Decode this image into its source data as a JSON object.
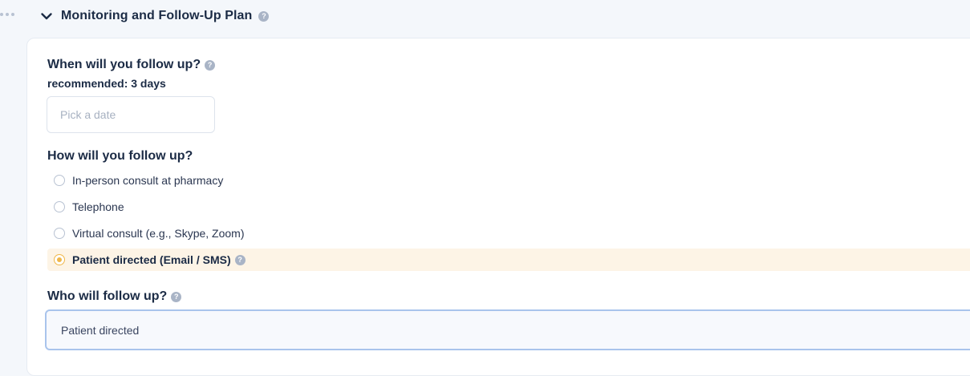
{
  "section": {
    "title": "Monitoring and Follow-Up Plan",
    "help_icon": "question-circle-icon",
    "expand_icon": "chevron-down-icon"
  },
  "follow_up_date": {
    "label": "When will you follow up?",
    "help_icon": "question-circle-icon",
    "recommended": "recommended: 3 days",
    "placeholder": "Pick a date",
    "value": ""
  },
  "follow_up_method": {
    "label": "How will you follow up?",
    "options": [
      {
        "label": "In-person consult at pharmacy",
        "selected": false
      },
      {
        "label": "Telephone",
        "selected": false
      },
      {
        "label": "Virtual consult (e.g., Skype, Zoom)",
        "selected": false
      },
      {
        "label": "Patient directed (Email / SMS)",
        "selected": true,
        "help_icon": "question-circle-icon"
      }
    ]
  },
  "follow_up_who": {
    "label": "Who will follow up?",
    "help_icon": "question-circle-icon",
    "value": "Patient directed"
  },
  "colors": {
    "accent_selected": "#f0b74a",
    "selected_row_bg": "#fdf4e6",
    "focus_border": "#a9c4ec",
    "help_icon": "#a9b4c6",
    "heading_text": "#1b2b45"
  }
}
